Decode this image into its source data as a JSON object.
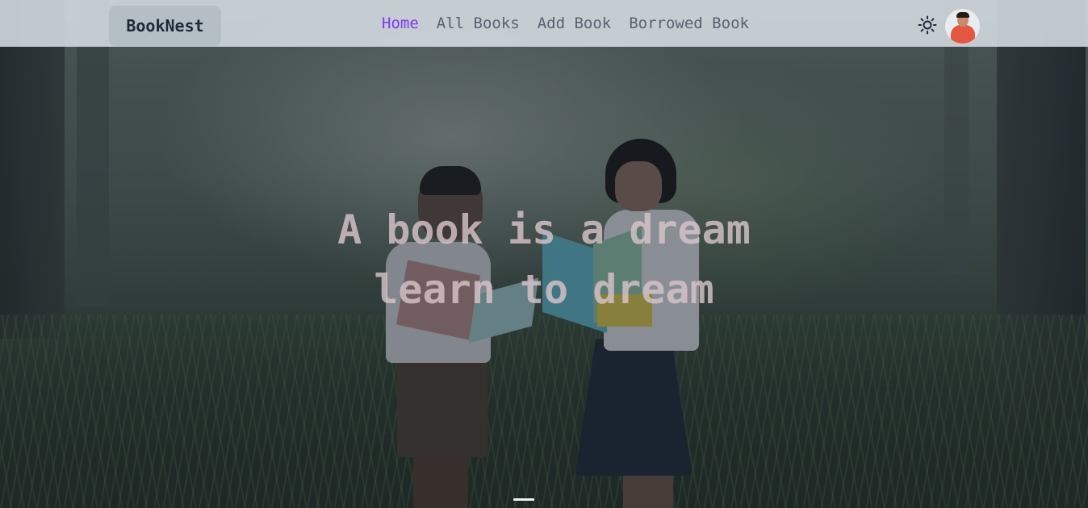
{
  "navbar": {
    "brand": "BookNest",
    "links": [
      {
        "label": "Home",
        "active": true
      },
      {
        "label": "All Books",
        "active": false
      },
      {
        "label": "Add Book",
        "active": false
      },
      {
        "label": "Borrowed Book",
        "active": false
      }
    ],
    "theme_icon": "sun-icon",
    "avatar_icon": "user-avatar"
  },
  "hero": {
    "line1": "A book is a dream",
    "line2": "learn to dream",
    "slide_active": 1
  },
  "colors": {
    "active_link": "#7c3aed",
    "nav_text": "#5b6170",
    "brand_bg": "#b0bac2"
  }
}
